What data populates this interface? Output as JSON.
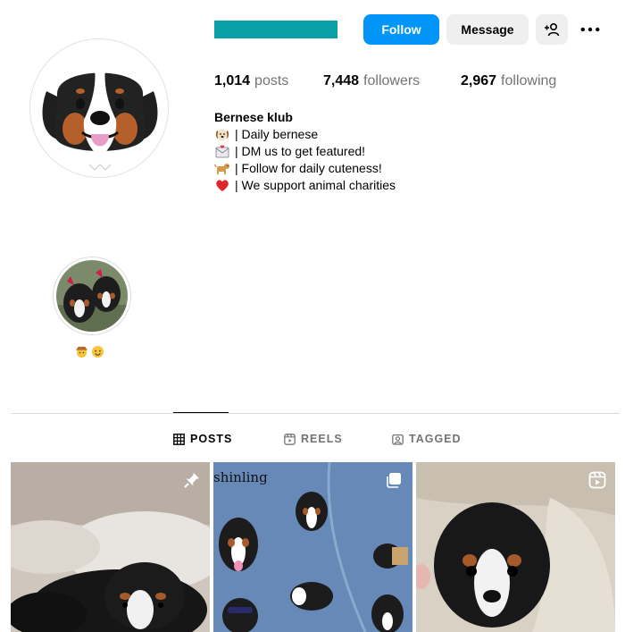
{
  "profile": {
    "username_bar_color": "#0aa0a8",
    "follow_label": "Follow",
    "message_label": "Message",
    "follow_color": "#0095f6",
    "add_user_icon": "person-add-icon",
    "more_icon": "more-options-icon"
  },
  "stats": {
    "posts_num": "1,014",
    "posts_label": "posts",
    "followers_num": "7,448",
    "followers_label": "followers",
    "following_num": "2,967",
    "following_label": "following"
  },
  "bio": {
    "name": "Bernese klub",
    "lines": [
      {
        "icon": "dog-face-icon",
        "text": "| Daily bernese"
      },
      {
        "icon": "envelope-icon",
        "text": "| DM us to get featured!"
      },
      {
        "icon": "dog-icon",
        "text": "| Follow for daily cuteness!"
      },
      {
        "icon": "red-heart-icon",
        "text": "| We support animal charities"
      }
    ]
  },
  "highlight": {
    "icons": [
      "cowboy-face-icon",
      "smiling-face-icon"
    ]
  },
  "tabs": [
    {
      "label": "POSTS",
      "icon": "grid-icon",
      "active": true
    },
    {
      "label": "REELS",
      "icon": "reels-icon",
      "active": false
    },
    {
      "label": "TAGGED",
      "icon": "tagged-icon",
      "active": false
    }
  ],
  "posts": [
    {
      "badge": "pin-icon",
      "alt": ""
    },
    {
      "badge": "carousel-icon",
      "caption": "shinling"
    },
    {
      "badge": "reel-icon",
      "alt": ""
    }
  ]
}
